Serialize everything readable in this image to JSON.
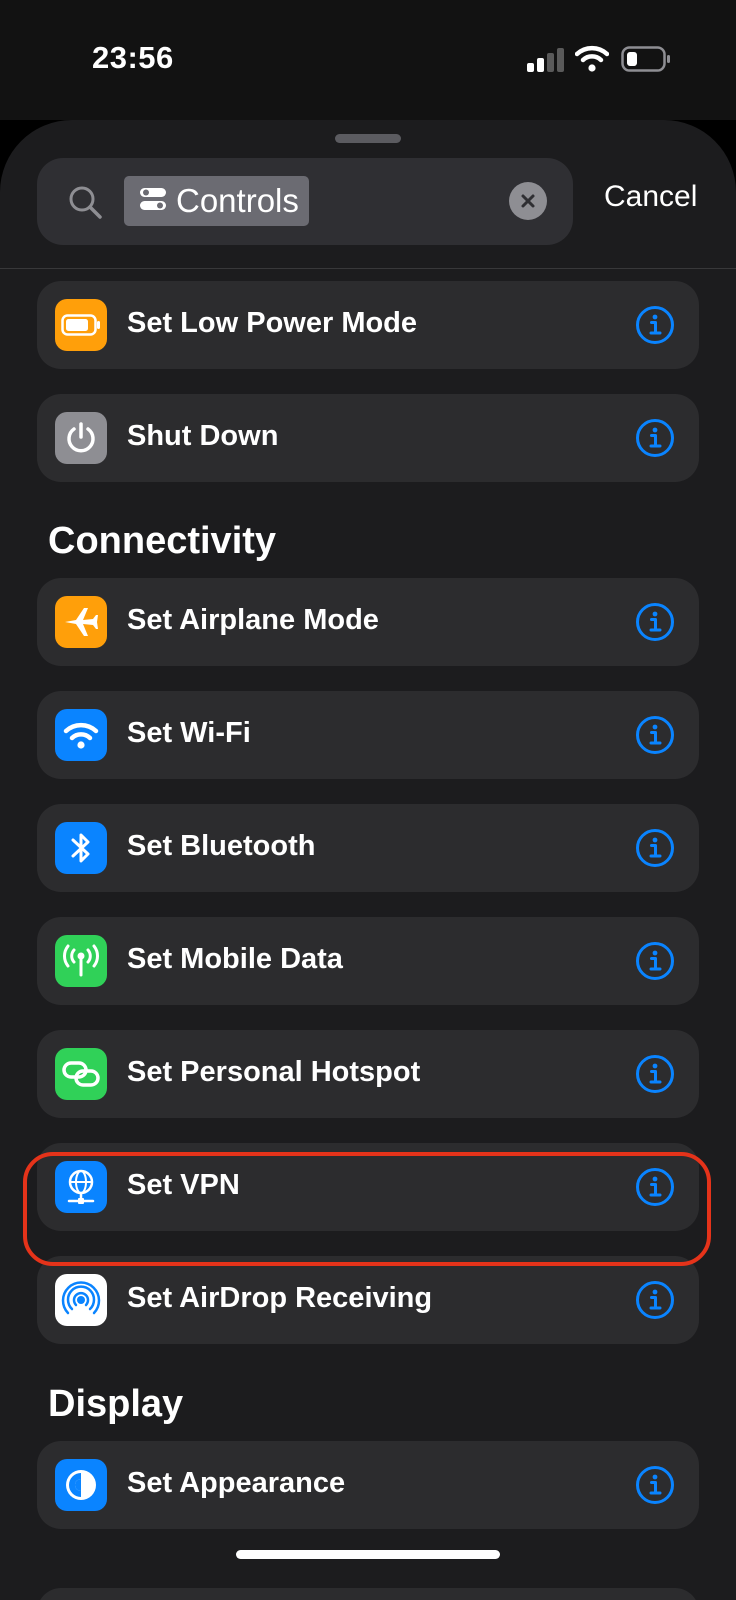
{
  "status": {
    "time": "23:56"
  },
  "search": {
    "token_label": "Controls",
    "cancel_label": "Cancel"
  },
  "rows_top": [
    {
      "label": "Set Low Power Mode",
      "icon": "battery-icon",
      "color": "#FF9F0A"
    },
    {
      "label": "Shut Down",
      "icon": "power-icon",
      "color": "#8E8E93"
    }
  ],
  "sections": [
    {
      "title": "Connectivity",
      "items": [
        {
          "label": "Set Airplane Mode",
          "icon": "airplane-icon",
          "color": "#FF9F0A"
        },
        {
          "label": "Set Wi-Fi",
          "icon": "wifi-icon",
          "color": "#0A84FF"
        },
        {
          "label": "Set Bluetooth",
          "icon": "bluetooth-icon",
          "color": "#0A84FF"
        },
        {
          "label": "Set Mobile Data",
          "icon": "antenna-icon",
          "color": "#30D158"
        },
        {
          "label": "Set Personal Hotspot",
          "icon": "link-icon",
          "color": "#30D158"
        },
        {
          "label": "Set VPN",
          "icon": "globe-network-icon",
          "color": "#0A84FF",
          "highlighted": true
        },
        {
          "label": "Set AirDrop Receiving",
          "icon": "airdrop-icon",
          "color": "#FFFFFF"
        }
      ]
    },
    {
      "title": "Display",
      "items": [
        {
          "label": "Set Appearance",
          "icon": "appearance-icon",
          "color": "#0A84FF"
        }
      ]
    }
  ],
  "colors": {
    "accent": "#0A84FF",
    "highlight_ring": "#E5331A",
    "sheet_bg": "#1C1C1E",
    "row_bg": "#2C2C2E"
  }
}
